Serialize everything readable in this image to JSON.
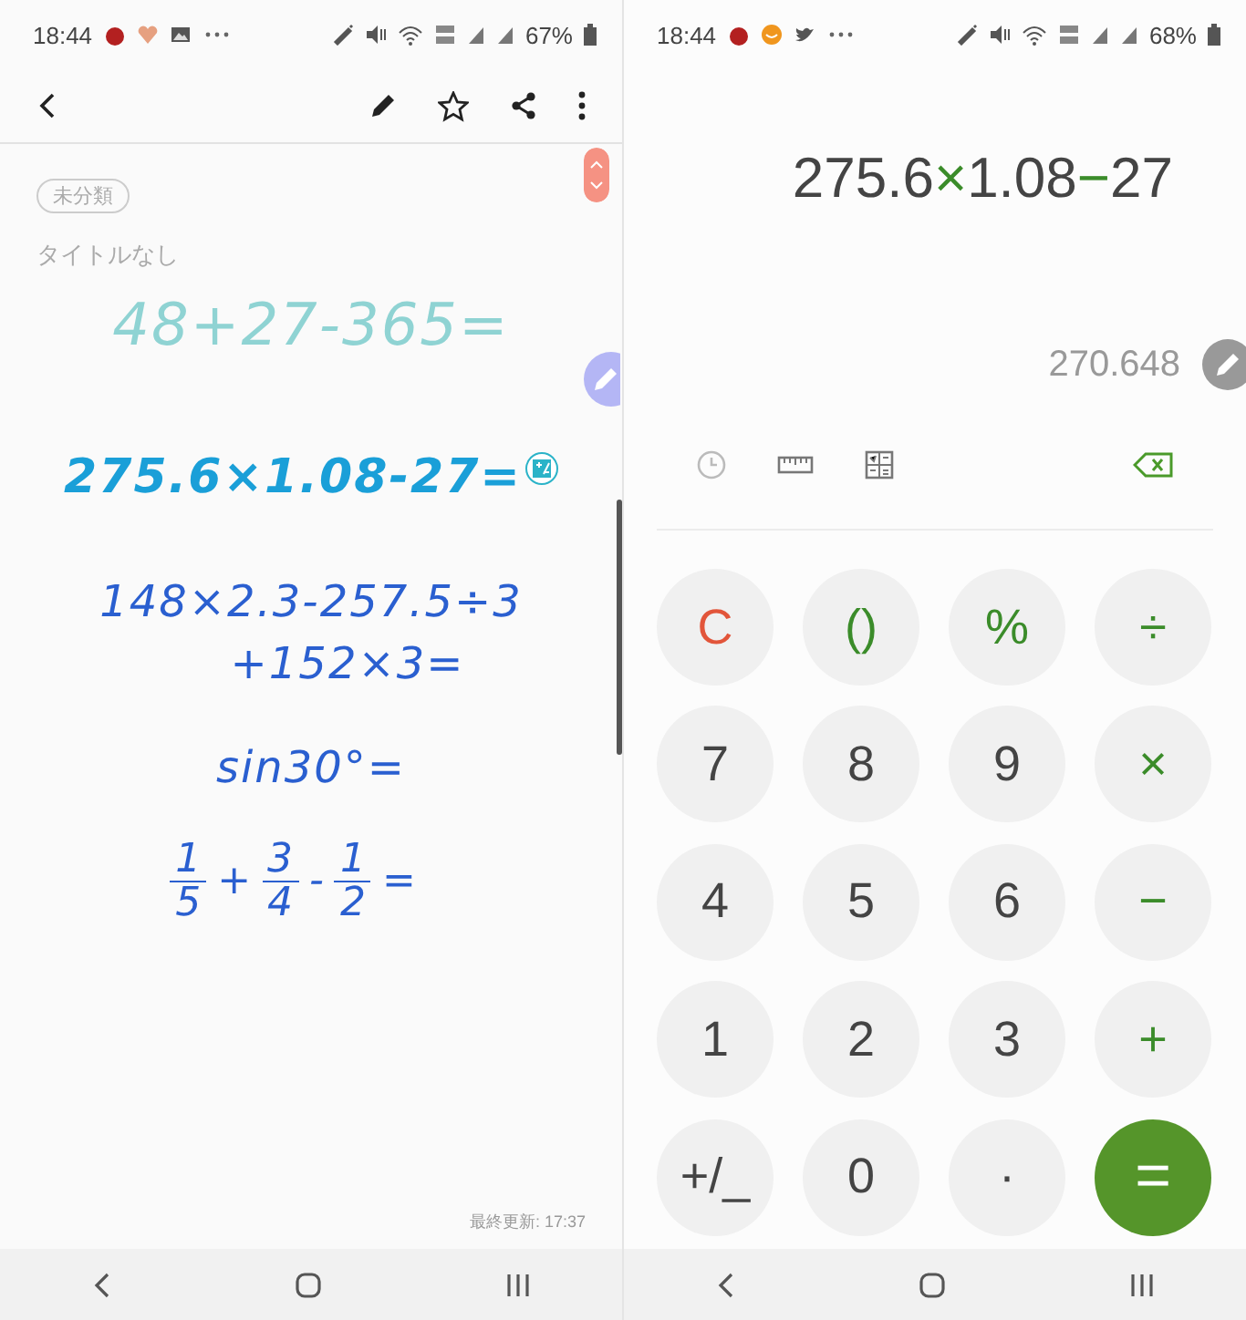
{
  "notes_screen": {
    "status_bar": {
      "time": "18:44",
      "battery": "67%"
    },
    "category_chip": "未分類",
    "title_placeholder": "タイトルなし",
    "handwriting": [
      {
        "kind": "line",
        "text": "48+27-365=",
        "color": "#8fd3d3"
      },
      {
        "kind": "line",
        "text": "275.6×1.08-27=",
        "color": "#1a9fd8"
      },
      {
        "kind": "line",
        "text": "148×2.3-257.5÷3",
        "color": "#2a5fd0"
      },
      {
        "kind": "line",
        "text": "+152×3=",
        "color": "#2a5fd0"
      },
      {
        "kind": "line",
        "text": "sin30°=",
        "color": "#2a5fd0"
      },
      {
        "kind": "fraction",
        "color": "#2a5fd0",
        "parts": [
          {
            "kind": "frac",
            "num": "1",
            "den": "5"
          },
          {
            "kind": "op",
            "text": "+"
          },
          {
            "kind": "frac",
            "num": "3",
            "den": "4"
          },
          {
            "kind": "op",
            "text": "-"
          },
          {
            "kind": "frac",
            "num": "1",
            "den": "2"
          },
          {
            "kind": "op",
            "text": "="
          }
        ]
      }
    ],
    "last_updated": "最終更新: 17:37"
  },
  "calculator_screen": {
    "status_bar": {
      "time": "18:44",
      "battery": "68%"
    },
    "expression": [
      {
        "kind": "num",
        "text": "275.6"
      },
      {
        "kind": "op",
        "text": "×"
      },
      {
        "kind": "num",
        "text": "1.08"
      },
      {
        "kind": "op",
        "text": "−"
      },
      {
        "kind": "num",
        "text": "27"
      }
    ],
    "result": "270.648",
    "keys": [
      {
        "label": "C",
        "kind": "clear"
      },
      {
        "label": "()",
        "kind": "op"
      },
      {
        "label": "%",
        "kind": "op"
      },
      {
        "label": "÷",
        "kind": "op"
      },
      {
        "label": "7",
        "kind": "digit"
      },
      {
        "label": "8",
        "kind": "digit"
      },
      {
        "label": "9",
        "kind": "digit"
      },
      {
        "label": "×",
        "kind": "op"
      },
      {
        "label": "4",
        "kind": "digit"
      },
      {
        "label": "5",
        "kind": "digit"
      },
      {
        "label": "6",
        "kind": "digit"
      },
      {
        "label": "−",
        "kind": "op"
      },
      {
        "label": "1",
        "kind": "digit"
      },
      {
        "label": "2",
        "kind": "digit"
      },
      {
        "label": "3",
        "kind": "digit"
      },
      {
        "label": "+",
        "kind": "op"
      },
      {
        "label": "+/_",
        "kind": "digit"
      },
      {
        "label": "0",
        "kind": "digit"
      },
      {
        "label": "·",
        "kind": "digit"
      },
      {
        "label": "=",
        "kind": "equals"
      }
    ]
  }
}
